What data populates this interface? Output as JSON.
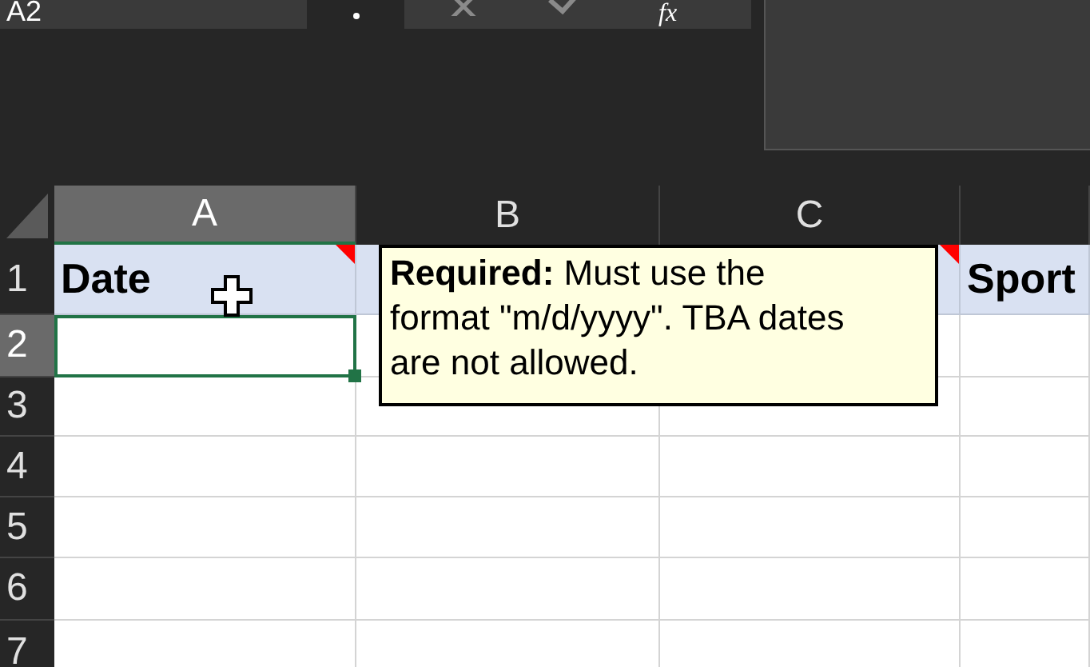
{
  "name_box": "A2",
  "formula_bar": {
    "fx": "fx"
  },
  "columns": [
    {
      "label": "A",
      "selected": true
    },
    {
      "label": "B",
      "selected": false
    },
    {
      "label": "C",
      "selected": false
    },
    {
      "selected": false
    }
  ],
  "rows": [
    {
      "label": "1",
      "selected": false
    },
    {
      "label": "2",
      "selected": true
    },
    {
      "label": "3",
      "selected": false
    },
    {
      "label": "4",
      "selected": false
    },
    {
      "label": "5",
      "selected": false
    },
    {
      "label": "6",
      "selected": false
    },
    {
      "label": "7",
      "selected": false
    }
  ],
  "header_cells": [
    {
      "text": "Date",
      "comment": true
    },
    {},
    {
      "comment": true
    },
    {
      "text": "Sport",
      "comment": false
    }
  ],
  "comment_tooltip": "**Required:** Must use the format \"m/d/yyyy\". TBA dates are not allowed."
}
